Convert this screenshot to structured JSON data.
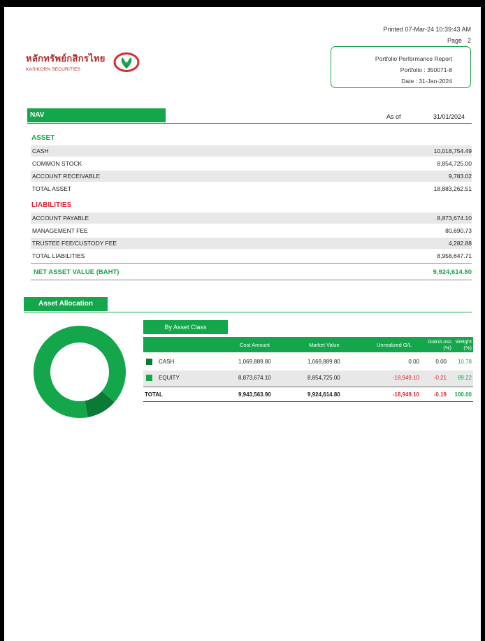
{
  "header": {
    "printed_label": "Printed",
    "printed_value": "07-Mar-24 10:39:43 AM",
    "page_label": "Page",
    "page_value": "2"
  },
  "logo": {
    "thai_name": "หลักทรัพย์กสิกรไทย",
    "english_name": "KASIKORN SECURITIES",
    "mark_colors": {
      "ring": "#e0282e",
      "leaf": "#1aa64a"
    }
  },
  "report": {
    "title": "Portfolio Performance Report",
    "portfolio": "Portfolio : 350071-8",
    "date": "Date : 31-Jan-2024"
  },
  "nav": {
    "title": "NAV",
    "as_of_label": "As of",
    "as_of_value": "31/01/2024",
    "asset_title": "ASSET",
    "assets": [
      {
        "label": "CASH",
        "value": "10,018,754.49"
      },
      {
        "label": "COMMON STOCK",
        "value": "8,854,725.00"
      },
      {
        "label": "ACCOUNT RECEIVABLE",
        "value": "9,783.02"
      },
      {
        "label": "TOTAL ASSET",
        "value": "18,883,262.51"
      }
    ],
    "liabilities_title": "LIABILITIES",
    "liabilities": [
      {
        "label": "ACCOUNT PAYABLE",
        "value": "8,873,674.10"
      },
      {
        "label": "MANAGEMENT FEE",
        "value": "80,690.73"
      },
      {
        "label": "TRUSTEE FEE/CUSTODY FEE",
        "value": "4,282.88"
      },
      {
        "label": "TOTAL LIABILITIES",
        "value": "8,958,647.71"
      }
    ],
    "net_label": "NET ASSET VALUE (BAHT)",
    "net_value": "9,924,614.80"
  },
  "allocation": {
    "title": "Asset Allocation",
    "tab_label": "By Asset Class",
    "columns": [
      "Cost Amount",
      "Market Value",
      "Unrealized G/L",
      "Gain/Loss (%)",
      "Weight (%)"
    ],
    "rows": [
      {
        "name": "CASH",
        "color": "#0b7a35",
        "cost": "1,069,889.80",
        "market": "1,069,889.80",
        "unrealized": "0.00",
        "gainloss": "0.00",
        "weight": "10.78"
      },
      {
        "name": "EQUITY",
        "color": "#14a64a",
        "cost": "8,873,674.10",
        "market": "8,854,725.00",
        "unrealized": "-18,949.10",
        "gainloss": "-0.21",
        "weight": "89.22"
      }
    ],
    "total": {
      "name": "TOTAL",
      "cost": "9,943,563.90",
      "market": "9,924,614.80",
      "unrealized": "-18,949.10",
      "gainloss": "-0.19",
      "weight": "100.00"
    }
  },
  "chart_data": {
    "type": "pie",
    "categories": [
      "CASH",
      "EQUITY"
    ],
    "values": [
      10.78,
      89.22
    ],
    "colors": [
      "#0b7a35",
      "#14a64a"
    ]
  }
}
